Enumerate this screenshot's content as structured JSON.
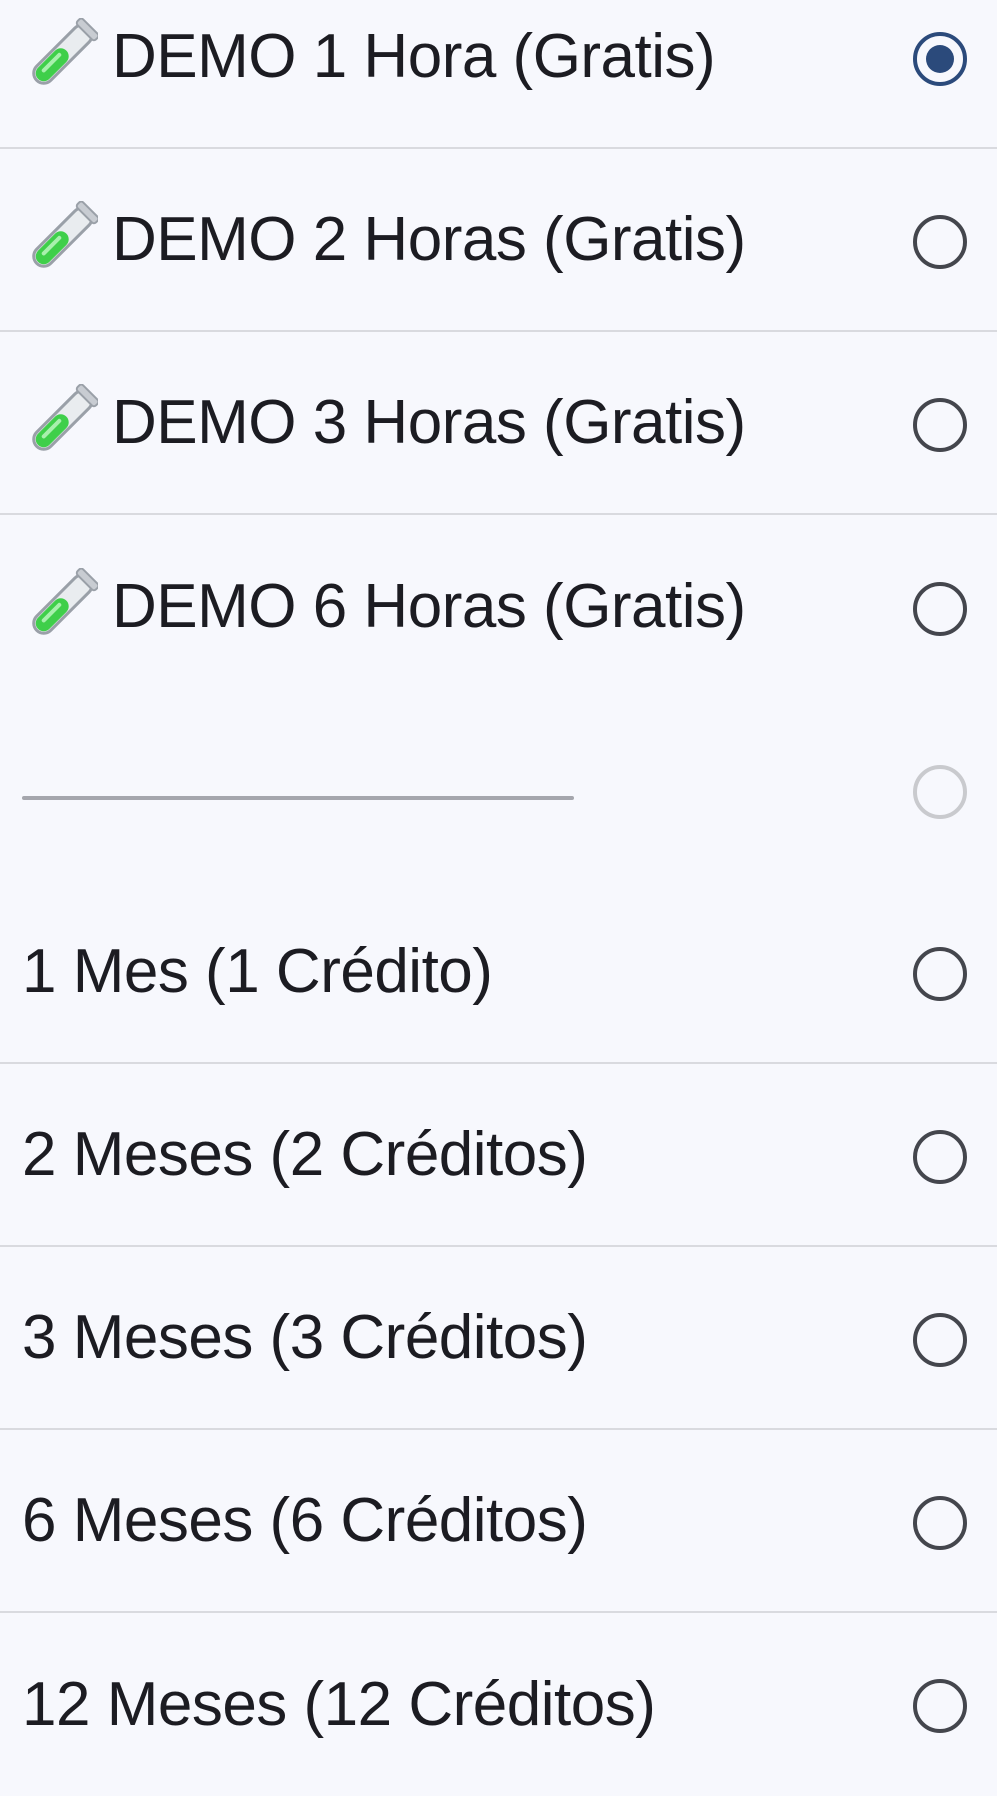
{
  "options": [
    {
      "label": "DEMO 1 Hora (Gratis)",
      "icon": "test-tube-icon",
      "selected": true
    },
    {
      "label": "DEMO 2 Horas (Gratis)",
      "icon": "test-tube-icon",
      "selected": false
    },
    {
      "label": "DEMO 3 Horas (Gratis)",
      "icon": "test-tube-icon",
      "selected": false
    },
    {
      "label": "DEMO 6 Horas (Gratis)",
      "icon": "test-tube-icon",
      "selected": false
    },
    {
      "label": "—————————————",
      "separator": true,
      "disabled": true,
      "selected": false
    },
    {
      "label": "1 Mes (1 Crédito)",
      "selected": false
    },
    {
      "label": "2 Meses (2 Créditos)",
      "selected": false
    },
    {
      "label": "3 Meses (3 Créditos)",
      "selected": false
    },
    {
      "label": "6 Meses (6 Créditos)",
      "selected": false
    },
    {
      "label": "12 Meses (12 Créditos)",
      "selected": false
    }
  ],
  "colors": {
    "background": "#f7f8fd",
    "divider": "#d9dadf",
    "radio_selected": "#2b4a7b",
    "radio_unselected": "#44464d",
    "radio_disabled": "#c9cace",
    "tube_liquid": "#3fcf4a"
  }
}
